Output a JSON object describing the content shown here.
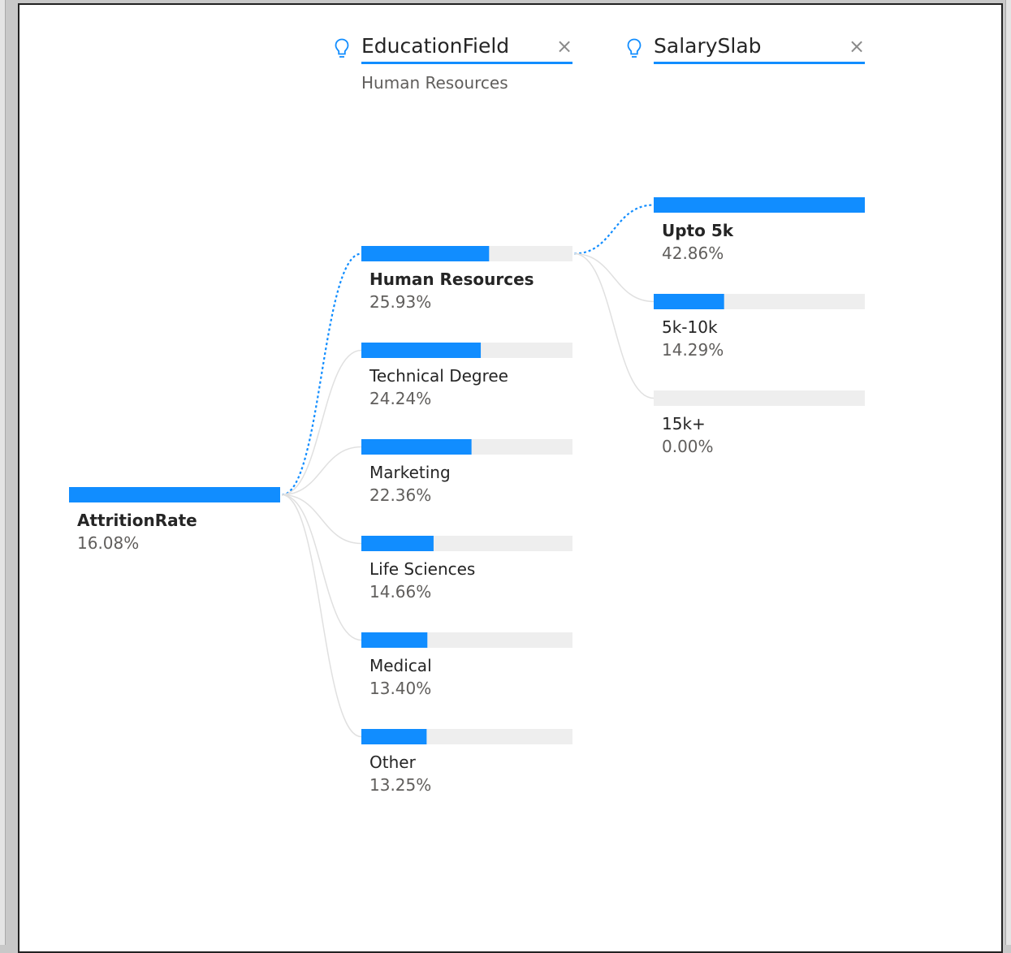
{
  "chart_data": {
    "type": "decomposition-tree",
    "colors": {
      "bar": "#118dff",
      "track": "#eeeeee",
      "connector": "#e0e0e0",
      "active_connector": "#118dff"
    },
    "levels": [
      {
        "header": "",
        "selected": "",
        "nodes": [
          {
            "label": "AttritionRate",
            "value": 16.08,
            "display": "16.08%",
            "selected": true
          }
        ]
      },
      {
        "header": "EducationField",
        "selected": "Human Resources",
        "nodes": [
          {
            "label": "Human Resources",
            "value": 25.93,
            "display": "25.93%",
            "selected": true
          },
          {
            "label": "Technical Degree",
            "value": 24.24,
            "display": "24.24%",
            "selected": false
          },
          {
            "label": "Marketing",
            "value": 22.36,
            "display": "22.36%",
            "selected": false
          },
          {
            "label": "Life Sciences",
            "value": 14.66,
            "display": "14.66%",
            "selected": false
          },
          {
            "label": "Medical",
            "value": 13.4,
            "display": "13.40%",
            "selected": false
          },
          {
            "label": "Other",
            "value": 13.25,
            "display": "13.25%",
            "selected": false
          }
        ]
      },
      {
        "header": "SalarySlab",
        "selected": "",
        "nodes": [
          {
            "label": "Upto 5k",
            "value": 42.86,
            "display": "42.86%",
            "selected": true
          },
          {
            "label": "5k-10k",
            "value": 14.29,
            "display": "14.29%",
            "selected": false
          },
          {
            "label": "15k+",
            "value": 0.0,
            "display": "0.00%",
            "selected": false
          }
        ]
      }
    ]
  },
  "headers": {
    "education": {
      "title": "EducationField",
      "selected": "Human Resources",
      "close": "×",
      "icon": "lightbulb-icon"
    },
    "salary": {
      "title": "SalarySlab",
      "selected": "",
      "close": "×",
      "icon": "lightbulb-icon"
    }
  }
}
